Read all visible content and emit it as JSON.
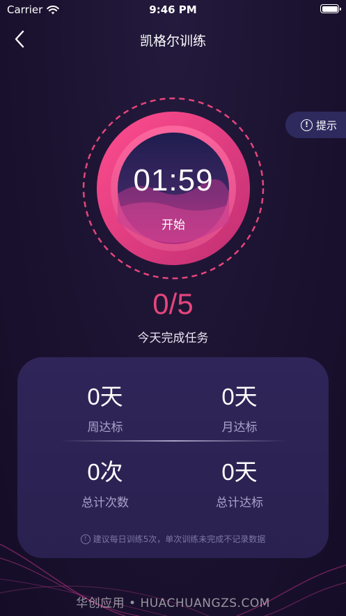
{
  "status_bar": {
    "carrier": "Carrier",
    "time": "9:46 PM"
  },
  "nav": {
    "title": "凯格尔训练"
  },
  "hint": {
    "label": "提示"
  },
  "timer": {
    "time": "01:59",
    "start_label": "开始"
  },
  "progress": {
    "count": "0/5",
    "label": "今天完成任务"
  },
  "stats": [
    {
      "value": "0天",
      "label": "周达标"
    },
    {
      "value": "0天",
      "label": "月达标"
    },
    {
      "value": "0次",
      "label": "总计次数"
    },
    {
      "value": "0天",
      "label": "总计达标"
    }
  ],
  "note": "建议每日训练5次，单次训练未完成不记录数据",
  "watermark": "华创应用 • HUACHUANGZS.COM",
  "colors": {
    "accent": "#e6457c",
    "background": "#1b1230",
    "card": "#2c2353"
  },
  "icons": {
    "back": "chevron-left-icon",
    "hint": "info-icon",
    "wifi": "wifi-icon",
    "battery": "battery-icon"
  }
}
